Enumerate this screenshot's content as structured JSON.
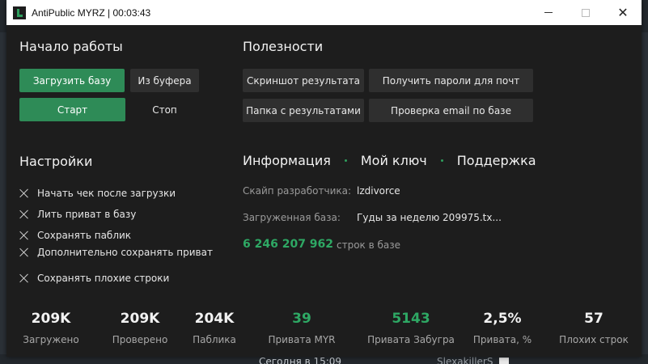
{
  "window": {
    "title": "AntiPublic MYRZ | 00:03:43"
  },
  "start": {
    "heading": "Начало работы",
    "load_base": "Загрузить базу",
    "from_buffer": "Из буфера",
    "start": "Старт",
    "stop": "Стоп"
  },
  "useful": {
    "heading": "Полезности",
    "screenshot": "Скриншот результата",
    "get_passwords": "Получить пароли для почт",
    "results_folder": "Папка с результатами",
    "check_email": "Проверка email по базе"
  },
  "settings": {
    "heading": "Настройки",
    "options": [
      "Начать чек после загрузки",
      "Лить приват в базу",
      "Сохранять паблик",
      "Дополнительно сохранять приват",
      "Сохранять плохие строки"
    ]
  },
  "info": {
    "tab_info": "Информация",
    "tab_key": "Мой ключ",
    "tab_support": "Поддержка",
    "skype_label": "Скайп разработчика:",
    "skype_value": "lzdivorce",
    "base_label": "Загруженная база:",
    "base_value": "Гуды за неделю 209975.tx...",
    "rows_count": "6 246 207 962",
    "rows_unit": "строк в базе"
  },
  "stats": [
    {
      "value": "209K",
      "label": "Загружено"
    },
    {
      "value": "209K",
      "label": "Проверено"
    },
    {
      "value": "204K",
      "label": "Паблика"
    },
    {
      "value": "39",
      "label": "Привата MYR"
    },
    {
      "value": "5143",
      "label": "Привата Забугра"
    },
    {
      "value": "2,5%",
      "label": "Привата, %"
    },
    {
      "value": "57",
      "label": "Плохих строк"
    }
  ],
  "background": {
    "date_text": "Сегодня в 15:09",
    "user_text": "SlexakillerS"
  },
  "colors": {
    "accent": "#2e8b57",
    "window_bg": "#1d1d1d",
    "number_green": "#2ea864"
  }
}
